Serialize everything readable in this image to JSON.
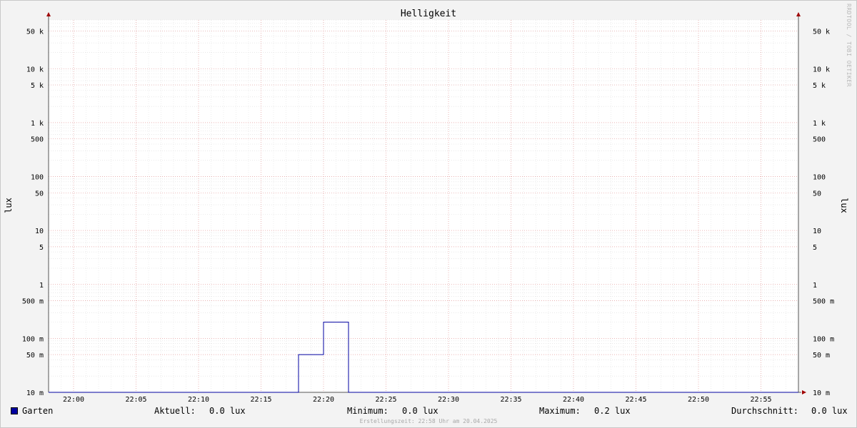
{
  "watermark": "RRDTOOL / TOBI OETIKER",
  "footer": "Erstellungszeit: 22:58 Uhr am 20.04.2025",
  "legend": {
    "series_name": "Garten",
    "series_color": "#0000a0",
    "current_label": "Aktuell:",
    "current_value": "0.0 lux",
    "min_label": "Minimum:",
    "min_value": "0.0 lux",
    "max_label": "Maximum:",
    "max_value": "0.2 lux",
    "avg_label": "Durchschnitt:",
    "avg_value": "0.0 lux"
  },
  "chart_data": {
    "type": "line",
    "title": "Helligkeit",
    "ylabel": "lux",
    "ylabel_right": "lux",
    "y_scale": "log",
    "ylim": [
      0.01,
      80000
    ],
    "y_ticks": [
      {
        "value": 0.01,
        "label": "10 m"
      },
      {
        "value": 0.05,
        "label": "50 m"
      },
      {
        "value": 0.1,
        "label": "100 m"
      },
      {
        "value": 0.5,
        "label": "500 m"
      },
      {
        "value": 1,
        "label": "1"
      },
      {
        "value": 5,
        "label": "5"
      },
      {
        "value": 10,
        "label": "10"
      },
      {
        "value": 50,
        "label": "50"
      },
      {
        "value": 100,
        "label": "100"
      },
      {
        "value": 500,
        "label": "500"
      },
      {
        "value": 1000,
        "label": "1 k"
      },
      {
        "value": 5000,
        "label": "5 k"
      },
      {
        "value": 10000,
        "label": "10 k"
      },
      {
        "value": 50000,
        "label": "50 k"
      }
    ],
    "x_ticks": [
      "22:00",
      "22:05",
      "22:10",
      "22:15",
      "22:20",
      "22:25",
      "22:30",
      "22:35",
      "22:40",
      "22:45",
      "22:50",
      "22:55"
    ],
    "xlim": [
      "21:58",
      "22:58"
    ],
    "grid": true,
    "series": [
      {
        "name": "Garten",
        "color": "#0000a0",
        "step": true,
        "points": [
          {
            "x": "21:58",
            "y": 0.0
          },
          {
            "x": "22:18",
            "y": 0.05
          },
          {
            "x": "22:20",
            "y": 0.2
          },
          {
            "x": "22:22",
            "y": 0.0
          },
          {
            "x": "22:58",
            "y": 0.0
          }
        ]
      }
    ]
  }
}
